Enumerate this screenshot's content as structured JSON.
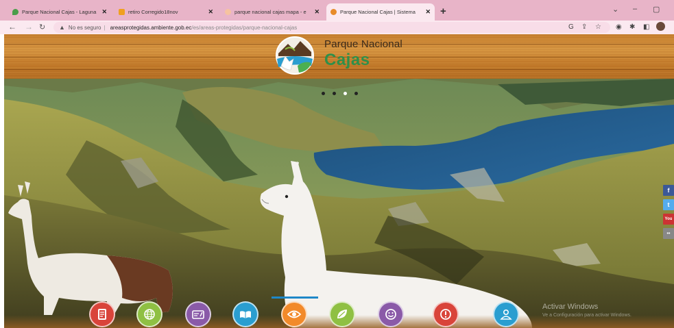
{
  "browser": {
    "tabs": [
      {
        "title": "Parque Nacional Cajas - Laguna",
        "favicon_color": "#4a9d4a",
        "active": false
      },
      {
        "title": "retiro Corregido18nov",
        "favicon_color": "#f0a020",
        "active": false
      },
      {
        "title": "parque nacional cajas mapa - e",
        "favicon_color": "#f6c3a0",
        "active": false
      },
      {
        "title": "Parque Nacional Cajas | Sistema",
        "favicon_color": "#e88b2a",
        "active": true
      }
    ],
    "new_tab": "+",
    "window_controls": [
      "⌄",
      "–",
      "▢"
    ],
    "address": {
      "security_label": "No es seguro",
      "host": "areasprotegidas.ambiente.gob.ec",
      "path": "/es/areas-protegidas/parque-nacional-cajas"
    }
  },
  "site": {
    "logo_line1": "Parque Nacional",
    "logo_line2": "Cajas"
  },
  "slider": {
    "dots": 4,
    "active_dot": 2
  },
  "social": [
    {
      "icon": "facebook-icon",
      "label": "f",
      "color": "#3b5998"
    },
    {
      "icon": "twitter-icon",
      "label": "t",
      "color": "#55acee"
    },
    {
      "icon": "youtube-icon",
      "label": "You",
      "color": "#cc3333"
    },
    {
      "icon": "flickr-icon",
      "label": "••",
      "color": "#888888"
    }
  ],
  "windows_watermark": {
    "line1": "Activar Windows",
    "line2": "Ve a Configuración para activar Windows."
  },
  "bottom_icons": [
    {
      "name": "document-icon",
      "color": "#d9443a"
    },
    {
      "name": "globe-icon",
      "color": "#8fc043"
    },
    {
      "name": "card-icon",
      "color": "#8a5aa8"
    },
    {
      "name": "book-icon",
      "color": "#2a9ed0"
    },
    {
      "name": "eye-icon",
      "color": "#f28a2a"
    },
    {
      "name": "leaf-icon",
      "color": "#8fc043"
    },
    {
      "name": "smiley-icon",
      "color": "#8a5aa8"
    },
    {
      "name": "alert-icon",
      "color": "#d9443a"
    },
    {
      "name": "person-icon",
      "color": "#2a9ed0"
    }
  ]
}
